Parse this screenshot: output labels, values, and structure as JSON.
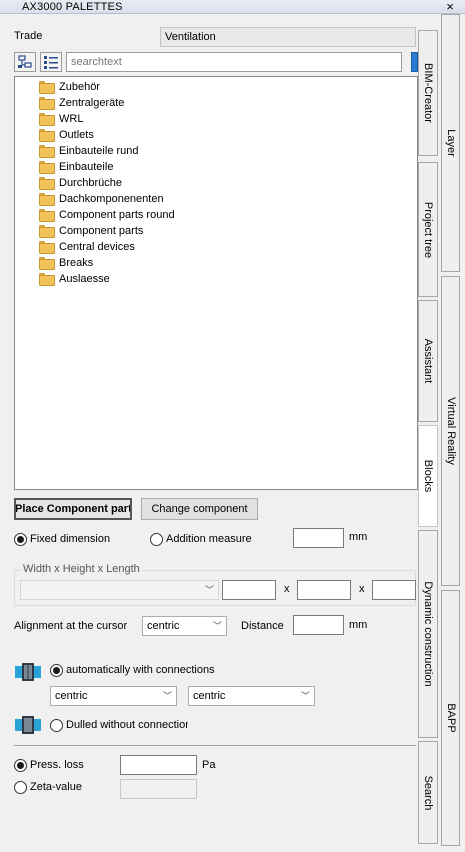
{
  "window": {
    "title": "AX3000 PALETTES",
    "close_label": "×"
  },
  "trade": {
    "label": "Trade",
    "value": "Ventilation"
  },
  "toolbar": {
    "search_placeholder": "searchtext"
  },
  "tree": {
    "items": [
      "Zubehör",
      "Zentralgeräte",
      "WRL",
      "Outlets",
      "Einbauteile rund",
      "Einbauteile",
      "Durchbrüche",
      "Dachkomponenenten",
      "Component parts round",
      "Component parts",
      "Central devices",
      "Breaks",
      "Auslaesse"
    ]
  },
  "buttons": {
    "place": "Place Component parts",
    "change": "Change component"
  },
  "dimension": {
    "fixed_label": "Fixed dimension",
    "addition_label": "Addition measure",
    "addition_value": "",
    "unit": "mm",
    "group_caption": "Width x Height x Length",
    "size_value": "",
    "x_sep": "x",
    "width": "",
    "height": "",
    "length": ""
  },
  "alignment": {
    "label": "Alignment at the cursor",
    "value": "centric",
    "distance_label": "Distance",
    "distance_value": "",
    "unit": "mm"
  },
  "connections": {
    "auto_label": "automatically with connections",
    "combo1": "centric",
    "combo2": "centric",
    "dulled_label": "Dulled without connections"
  },
  "loss": {
    "press_label": "Press. loss",
    "press_value": "",
    "press_unit": "Pa",
    "zeta_label": "Zeta-value",
    "zeta_value": ""
  },
  "tabs_inner": [
    "BIM-Creator",
    "Project tree",
    "Assistant",
    "Blocks",
    "Dynamic construction",
    "Search"
  ],
  "tabs_outer": [
    "Layer",
    "Virtual Reality",
    "BAPP"
  ],
  "colors": {
    "accent": "#2a7ad4",
    "folder": "#f2c35a"
  }
}
